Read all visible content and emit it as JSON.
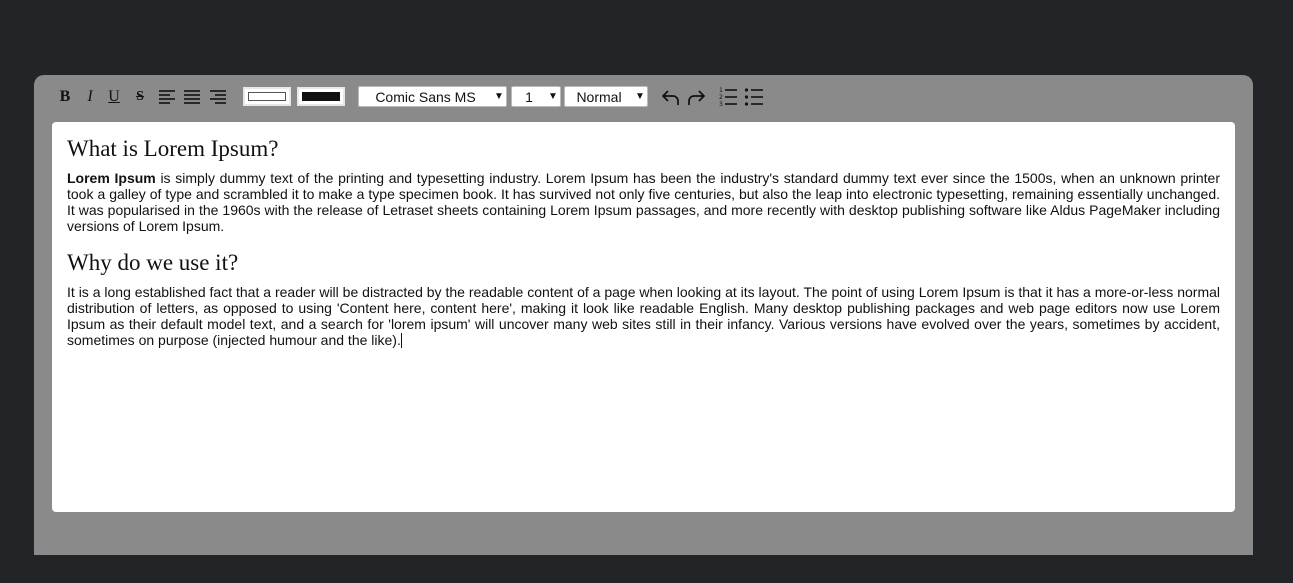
{
  "toolbar": {
    "bold_label": "B",
    "italic_label": "I",
    "underline_label": "U",
    "strike_label": "S",
    "font_family": "Comic Sans MS",
    "font_size": "1",
    "block_format": "Normal",
    "icons": [
      "align-left-icon",
      "align-justify-icon",
      "align-right-icon",
      "undo-icon",
      "redo-icon",
      "ordered-list-icon",
      "unordered-list-icon"
    ],
    "text_color": "#ffffff",
    "background_color": "#111111"
  },
  "document": {
    "heading1": "What is Lorem Ipsum?",
    "para1_bold": "Lorem Ipsum",
    "para1_rest": " is simply dummy text of the printing and typesetting industry. Lorem Ipsum has been the industry's standard dummy text ever since the 1500s, when an unknown printer took a galley of type and scrambled it to make a type specimen book. It has survived not only five centuries, but also the leap into electronic typesetting, remaining essentially unchanged. It was popularised in the 1960s with the release of Letraset sheets containing Lorem Ipsum passages, and more recently with desktop publishing software like Aldus PageMaker including versions of Lorem Ipsum.",
    "heading2": "Why do we use it?",
    "para2": "It is a long established fact that a reader will be distracted by the readable content of a page when looking at its layout. The point of using Lorem Ipsum is that it has a more-or-less normal distribution of letters, as opposed to using 'Content here, content here', making it look like readable English. Many desktop publishing packages and web page editors now use Lorem Ipsum as their default model text, and a search for 'lorem ipsum' will uncover many web sites still in their infancy. Various versions have evolved over the years, sometimes by accident, sometimes on purpose (injected humour and the like)."
  }
}
